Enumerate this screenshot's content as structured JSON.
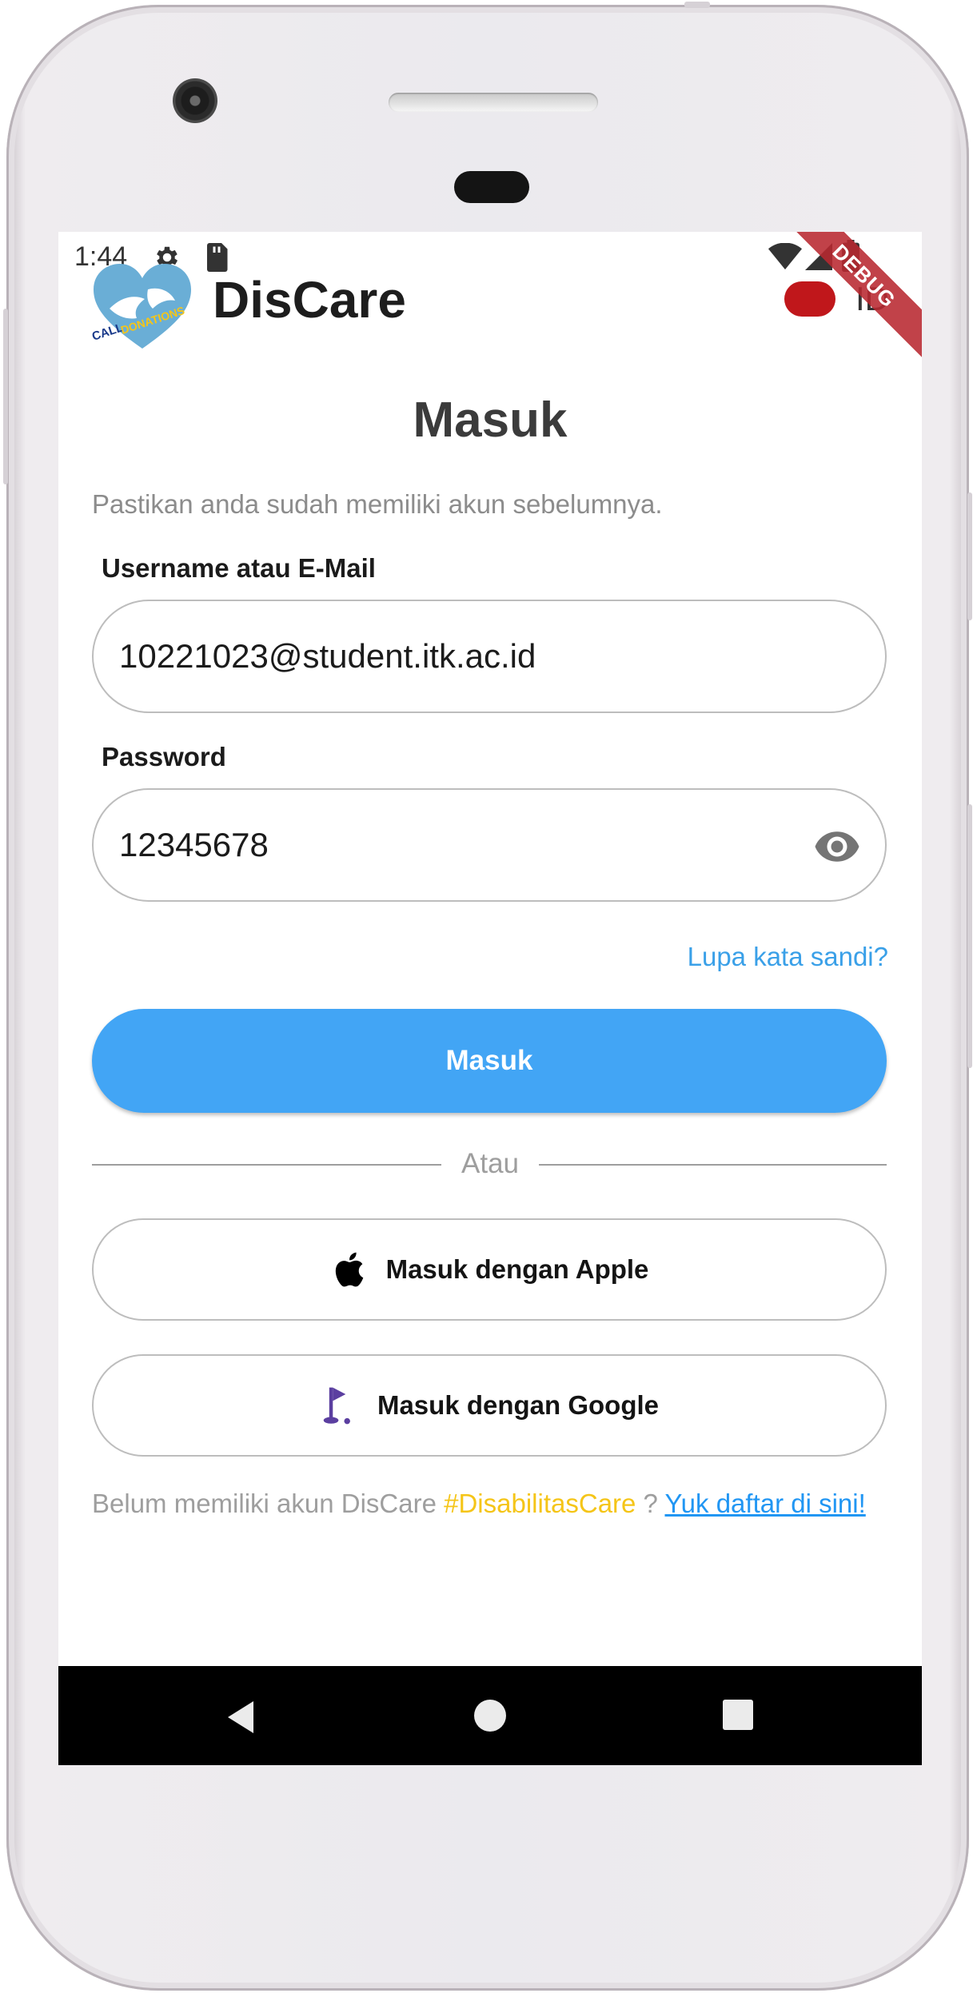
{
  "status_bar": {
    "time": "1:44"
  },
  "app_bar": {
    "title": "DisCare",
    "language": "ID",
    "debug_banner": "DEBUG"
  },
  "login": {
    "heading": "Masuk",
    "subtitle": "Pastikan anda sudah memiliki akun sebelumnya.",
    "username": {
      "label": "Username atau E-Mail",
      "value": "10221023@student.itk.ac.id"
    },
    "password": {
      "label": "Password",
      "value": "12345678"
    },
    "forgot_password": "Lupa kata sandi?",
    "submit_label": "Masuk",
    "divider_text": "Atau",
    "apple_label": "Masuk dengan Apple",
    "google_label": "Masuk dengan Google",
    "signup": {
      "prefix": "Belum memiliki akun DisCare ",
      "hashtag": "#DisabilitasCare",
      "middle": " ? ",
      "link": "Yuk daftar di sini!"
    }
  },
  "colors": {
    "primary": "#42a5f5",
    "link": "#3aa0e8",
    "hashtag": "#f5c518",
    "language_indicator": "#c0171b"
  }
}
